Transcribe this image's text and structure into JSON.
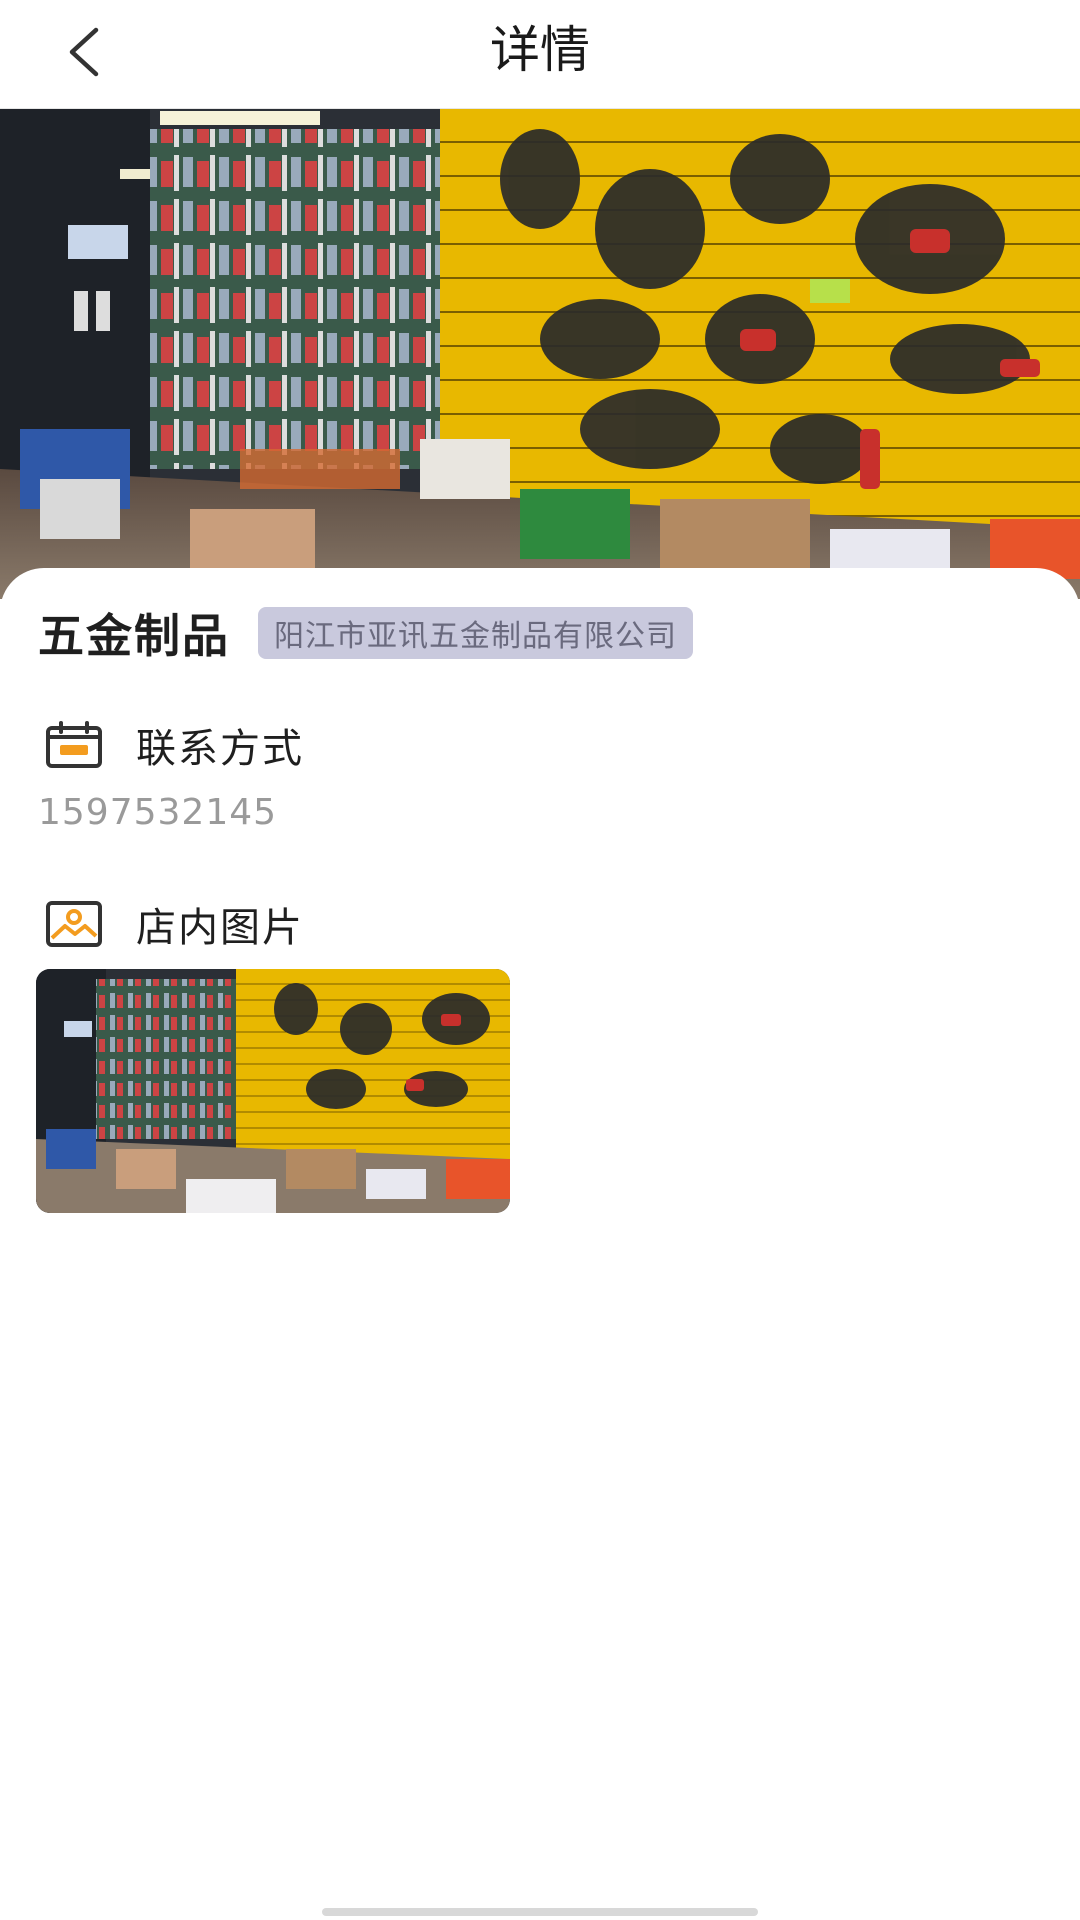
{
  "header": {
    "title": "详情",
    "back_icon": "chevron-left-icon"
  },
  "hero": {
    "image": "shop-interior-photo"
  },
  "shop": {
    "name": "五金制品",
    "company": "阳江市亚讯五金制品有限公司"
  },
  "contact": {
    "title": "联系方式",
    "icon": "calendar-icon",
    "phone": "1597532145"
  },
  "gallery": {
    "title": "店内图片",
    "icon": "image-icon",
    "images": [
      "shop-interior-thumbnail"
    ]
  },
  "colors": {
    "accent": "#f39c1f",
    "badge_bg": "#c9c9dd",
    "badge_text": "#6a6a7e",
    "shelf_yellow": "#f2c300"
  }
}
